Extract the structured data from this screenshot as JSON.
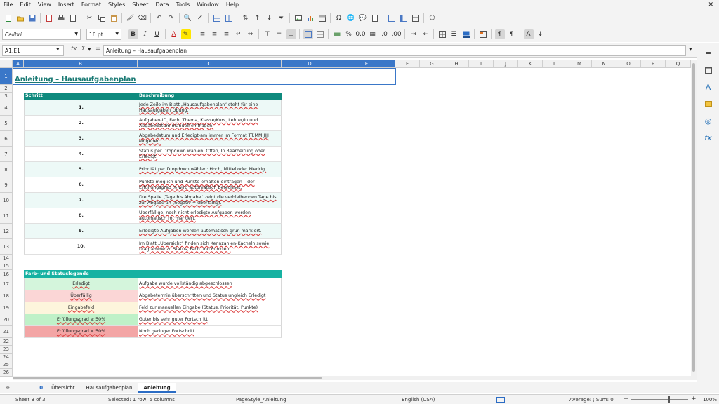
{
  "menu": {
    "items": [
      "File",
      "Edit",
      "View",
      "Insert",
      "Format",
      "Styles",
      "Sheet",
      "Data",
      "Tools",
      "Window",
      "Help"
    ],
    "close": "✕"
  },
  "toolbar": {
    "font_name": "Calibri",
    "font_size": "16 pt"
  },
  "formula_bar": {
    "name_box": "A1:E1",
    "fx": "fx",
    "sigma": "Σ",
    "equals": "=",
    "content": "Anleitung – Hausaufgabenplan"
  },
  "columns": [
    "A",
    "B",
    "C",
    "D",
    "E",
    "F",
    "G",
    "H",
    "I",
    "J",
    "K",
    "L",
    "M",
    "N",
    "O",
    "P",
    "Q"
  ],
  "rows": [
    "1",
    "2",
    "3",
    "4",
    "5",
    "6",
    "7",
    "8",
    "9",
    "10",
    "11",
    "12",
    "13",
    "14",
    "15",
    "16",
    "17",
    "18",
    "19",
    "20",
    "21",
    "22",
    "23",
    "24",
    "25",
    "26"
  ],
  "sheet": {
    "title": "Anleitung – Hausaufgabenplan",
    "table_headers": {
      "step": "Schritt",
      "desc": "Beschreibung"
    },
    "steps": [
      {
        "n": "1.",
        "text": "Jede Zeile im Blatt „Hausaufgabenplan“ steht für eine Hausaufgabe / Übung."
      },
      {
        "n": "2.",
        "text": "Aufgaben-ID, Fach, Thema, Klasse/Kurs, Lehrer/in und Abgabedatum manuell eintragen."
      },
      {
        "n": "3.",
        "text": "Abgabedatum und Erledigt-am immer im Format TT.MM.JJJJ eingeben."
      },
      {
        "n": "4.",
        "text": "Status per Dropdown wählen: Offen, In Bearbeitung oder Erledigt."
      },
      {
        "n": "5.",
        "text": "Priorität per Dropdown wählen: Hoch, Mittel oder Niedrig."
      },
      {
        "n": "6.",
        "text": "Punkte möglich und Punkte erhalten eintragen – der Erfüllungsgrad % wird automatisch berechnet."
      },
      {
        "n": "7.",
        "text": "Die Spalte „Tage bis Abgabe“ zeigt die verbleibenden Tage bis zur Abgabe an (negativ = überfällig)."
      },
      {
        "n": "8.",
        "text": "Überfällige, noch nicht erledigte Aufgaben werden automatisch rot markiert."
      },
      {
        "n": "9.",
        "text": "Erledigte Aufgaben werden automatisch grün markiert."
      },
      {
        "n": "10.",
        "text": "Im Blatt „Übersicht“ finden sich Kennzahlen-Kacheln sowie Diagramme zu Status, Fach und Punkten."
      }
    ],
    "legend_title": "Farb- und Statuslegende",
    "legend": [
      {
        "label": "Erledigt",
        "text": "Aufgabe wurde vollständig abgeschlossen",
        "color": "#d4f5dc"
      },
      {
        "label": "Überfällig",
        "text": "Abgabetermin überschritten und Status ungleich Erledigt",
        "color": "#fbd6d6"
      },
      {
        "label": "Eingabefeld",
        "text": "Feld zur manuellen Eingabe (Status, Priorität, Punkte)",
        "color": "#fdf5dc"
      },
      {
        "label": "Erfüllungsgrad ≥ 50%",
        "text": "Guter bis sehr guter Fortschritt",
        "color": "#bff1c8"
      },
      {
        "label": "Erfüllungsgrad < 50%",
        "text": "Noch geringer Fortschritt",
        "color": "#f3a5a5"
      }
    ]
  },
  "tabs": {
    "counter": "0",
    "items": [
      "Übersicht",
      "Hausaufgabenplan",
      "Anleitung"
    ]
  },
  "status": {
    "sheet": "Sheet 3 of 3",
    "selection": "Selected: 1 row, 5 columns",
    "page_style": "PageStyle_Anleitung",
    "language": "English (USA)",
    "summary": "Average: ; Sum: 0",
    "zoom": "100%"
  }
}
